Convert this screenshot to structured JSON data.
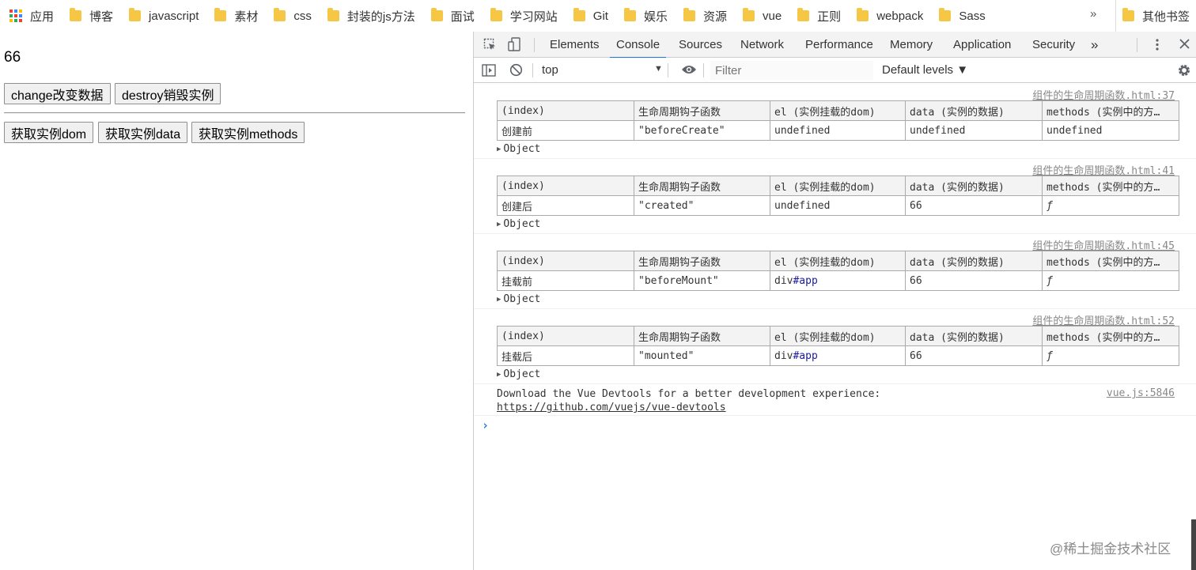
{
  "bookmarks": {
    "apps_label": "应用",
    "items": [
      "博客",
      "javascript",
      "素材",
      "css",
      "封装的js方法",
      "面试",
      "学习网站",
      "Git",
      "娱乐",
      "资源",
      "vue",
      "正则",
      "webpack",
      "Sass"
    ],
    "more": "»",
    "other": "其他书签"
  },
  "page": {
    "count": "66",
    "buttons_row1": [
      "change改变数据",
      "destroy销毁实例"
    ],
    "buttons_row2": [
      "获取实例dom",
      "获取实例data",
      "获取实例methods"
    ]
  },
  "devtools": {
    "tabs": [
      "Elements",
      "Console",
      "Sources",
      "Network",
      "Performance",
      "Memory",
      "Application",
      "Security"
    ],
    "active_tab": "Console",
    "overflow": "»",
    "context": "top",
    "filter_placeholder": "Filter",
    "levels": "Default levels ▼"
  },
  "console": {
    "columns": [
      "(index)",
      "生命周期钩子函数",
      "el (实例挂载的dom)",
      "data (实例的数据)",
      "methods (实例中的方…"
    ],
    "object_label": "Object",
    "entries": [
      {
        "source": "组件的生命周期函数.html:37",
        "index": "创建前",
        "hook": "\"beforeCreate\"",
        "el_tag": "undefined",
        "el_id": "",
        "data": "undefined",
        "methods": "undefined"
      },
      {
        "source": "组件的生命周期函数.html:41",
        "index": "创建后",
        "hook": "\"created\"",
        "el_tag": "undefined",
        "el_id": "",
        "data": "66",
        "methods": "ƒ"
      },
      {
        "source": "组件的生命周期函数.html:45",
        "index": "挂载前",
        "hook": "\"beforeMount\"",
        "el_tag": "div",
        "el_id": "#app",
        "data": "66",
        "methods": "ƒ"
      },
      {
        "source": "组件的生命周期函数.html:52",
        "index": "挂载后",
        "hook": "\"mounted\"",
        "el_tag": "div",
        "el_id": "#app",
        "data": "66",
        "methods": "ƒ"
      }
    ],
    "vue_message": "Download the Vue Devtools for a better development experience:",
    "vue_link": "https://github.com/vuejs/vue-devtools",
    "vue_source": "vue.js:5846",
    "prompt": "›"
  },
  "watermark": "@稀土掘金技术社区",
  "colors": {
    "accent": "#1a73e8",
    "string": "#c41a16",
    "number": "#1c00cf",
    "folder": "#f6c744"
  }
}
